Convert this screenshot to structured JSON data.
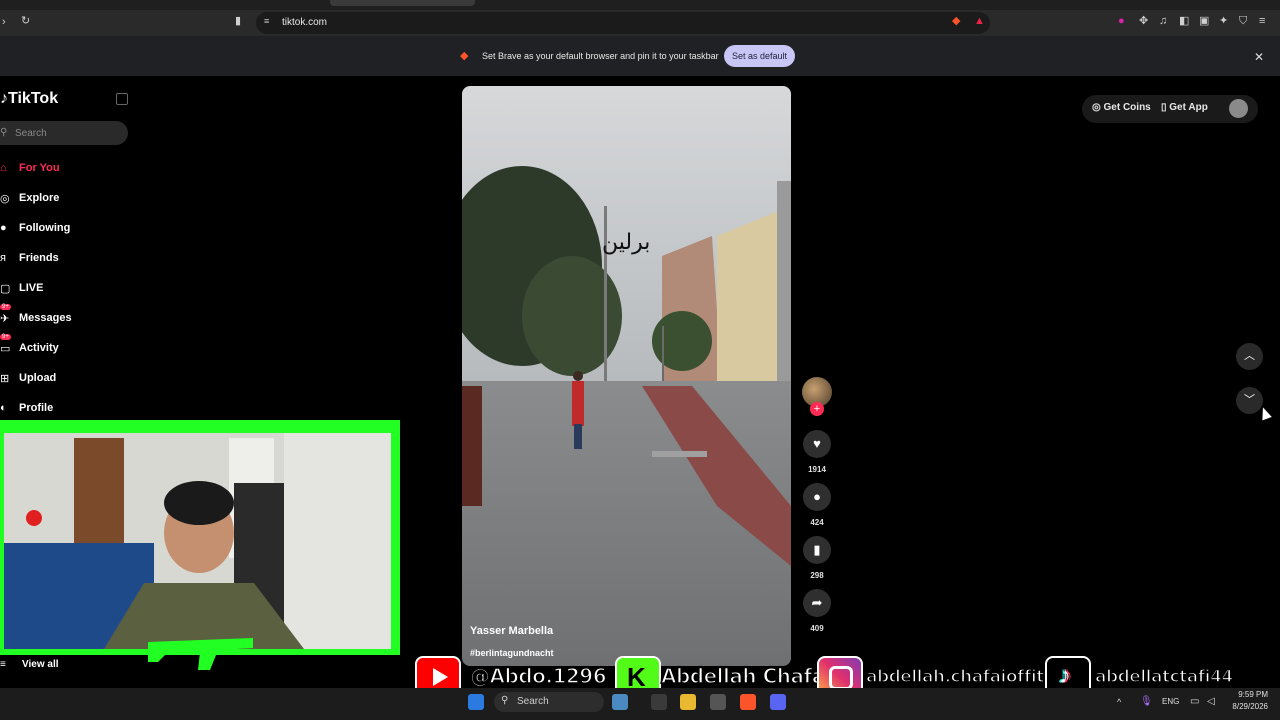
{
  "browser": {
    "url": "tiktok.com",
    "infobar_text": "Set Brave as your default browser and pin it to your taskbar",
    "infobar_button": "Set as default"
  },
  "sidebar": {
    "logo": "TikTok",
    "search_placeholder": "Search",
    "items": [
      {
        "label": "For You",
        "icon": "home-icon",
        "active": true
      },
      {
        "label": "Explore",
        "icon": "compass-icon"
      },
      {
        "label": "Following",
        "icon": "following-icon"
      },
      {
        "label": "Friends",
        "icon": "friends-icon"
      },
      {
        "label": "LIVE",
        "icon": "live-icon"
      },
      {
        "label": "Messages",
        "icon": "messages-icon",
        "badge": "9+"
      },
      {
        "label": "Activity",
        "icon": "activity-icon",
        "badge": "9+"
      },
      {
        "label": "Upload",
        "icon": "upload-icon"
      },
      {
        "label": "Profile",
        "icon": "profile-icon"
      }
    ],
    "view_all": "View all"
  },
  "video": {
    "author": "Yasser Marbella",
    "hashtag": "#berlintagundnacht",
    "overlay_text": "برلين"
  },
  "actions": {
    "likes": "1914",
    "comments": "424",
    "bookmarks": "298",
    "shares": "409"
  },
  "header": {
    "get_coins": "Get Coins",
    "get_app": "Get App"
  },
  "socials": {
    "youtube": "@Abdo.1296",
    "kick": "Abdellah Chafai",
    "instagram": "abdellah.chafaioffitid",
    "tiktok": "abdellatctafi44"
  },
  "taskbar": {
    "search": "Search",
    "lang": "ENG",
    "time": "9:59 PM",
    "date": "8/29/2026"
  },
  "colors": {
    "accent": "#fe2c55",
    "webcam_border": "#22ff22",
    "infobar_button": "#c8c6f5"
  }
}
